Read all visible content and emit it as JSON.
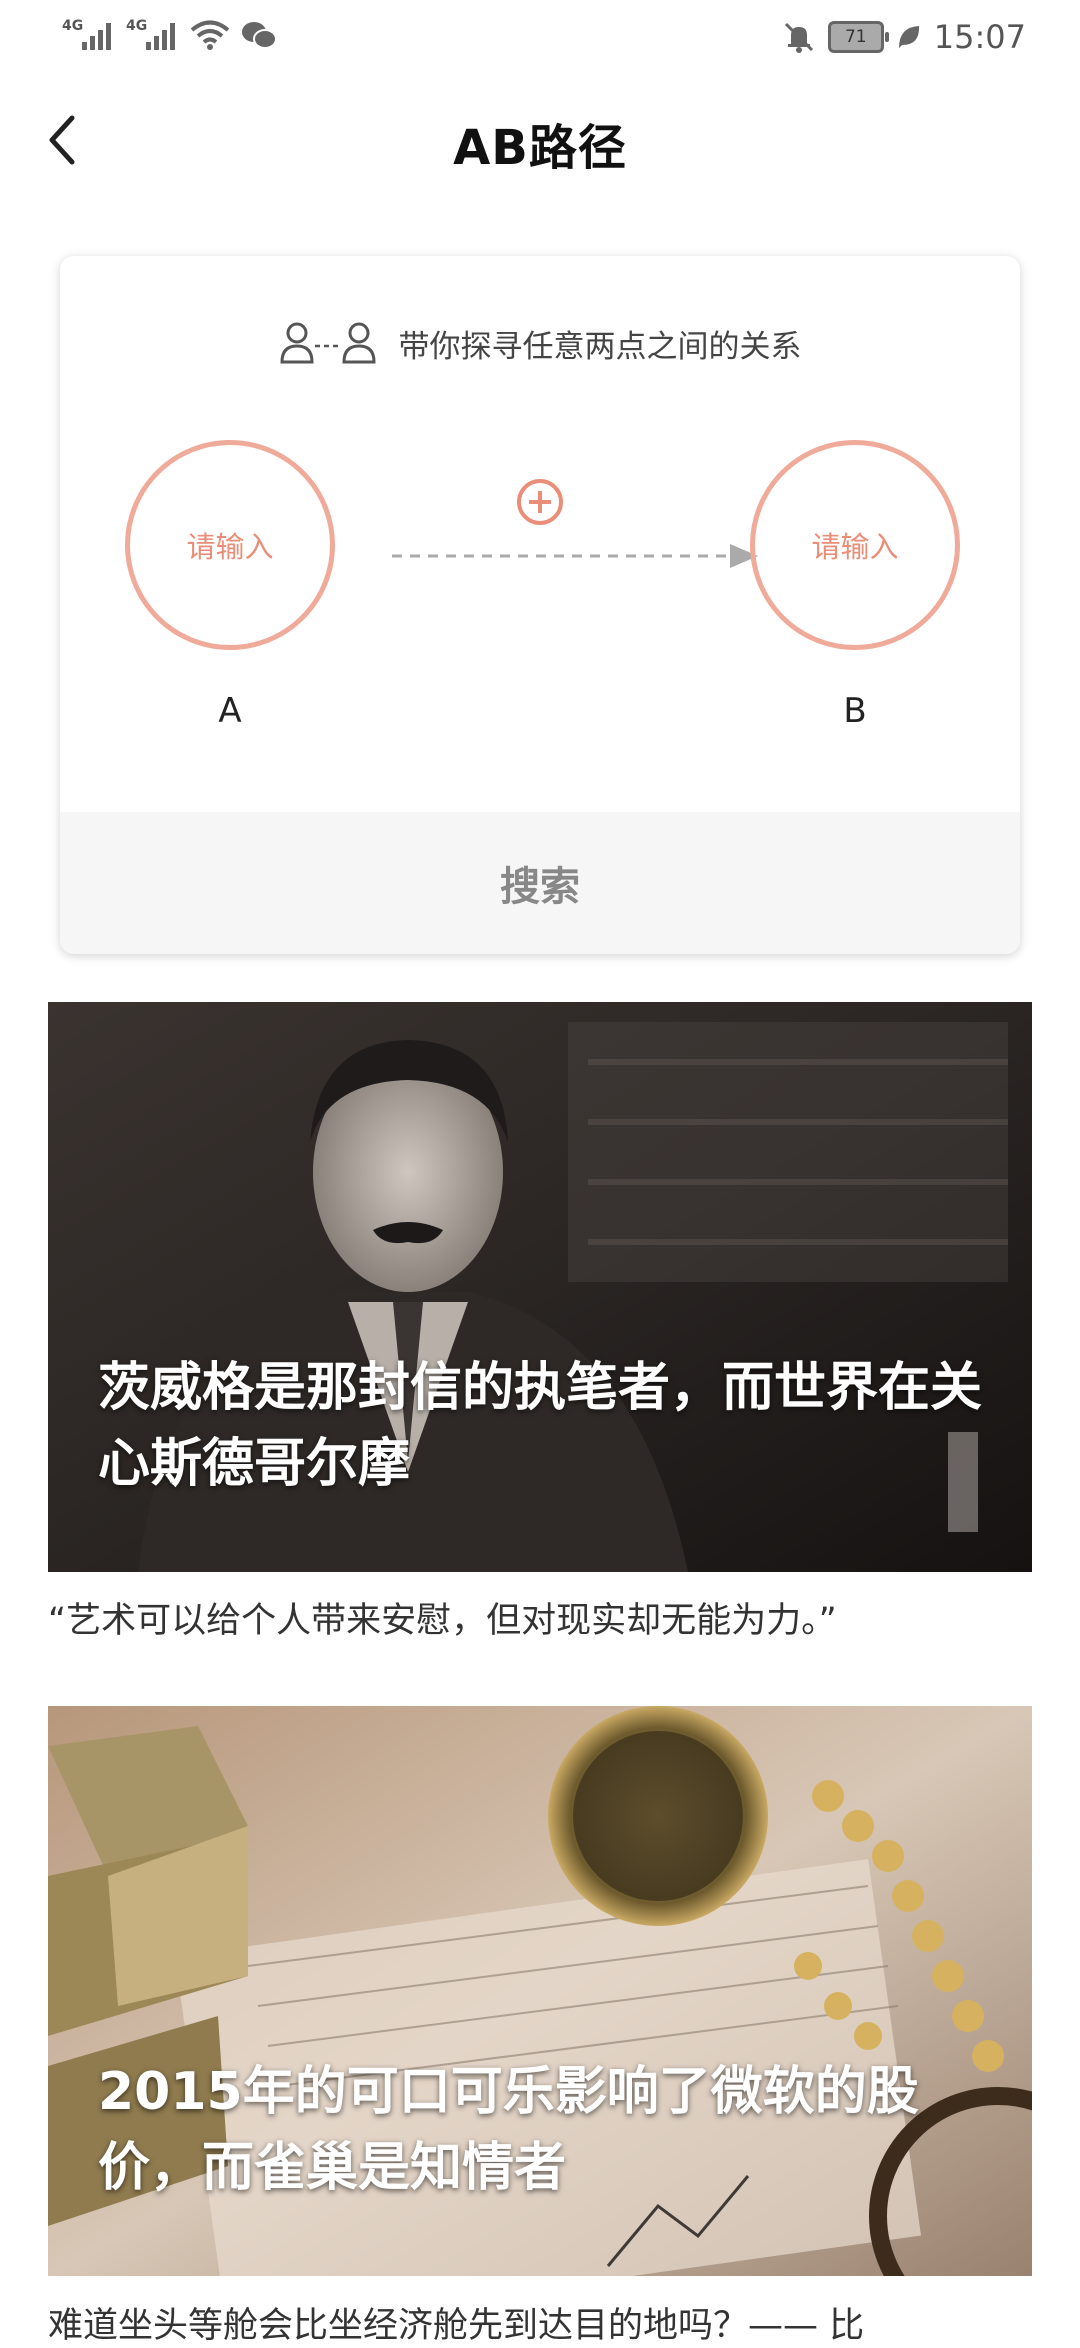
{
  "status_bar": {
    "signal1_label": "4G",
    "signal2_label": "4G",
    "battery": "71",
    "time": "15:07",
    "icons": [
      "signal-icon",
      "signal-icon",
      "wifi-icon",
      "wechat-icon",
      "mute-bell-icon",
      "battery-icon",
      "leaf-icon"
    ]
  },
  "header": {
    "title": "AB路径",
    "back_icon": "chevron-left-icon"
  },
  "card": {
    "subtitle": "带你探寻任意两点之间的关系",
    "node_a": {
      "placeholder": "请输入",
      "label": "A"
    },
    "node_b": {
      "placeholder": "请输入",
      "label": "B"
    },
    "add_icon": "plus-circle-icon",
    "search_label": "搜索",
    "accent_color": "#f0aa9a"
  },
  "articles": [
    {
      "title": "茨威格是那封信的执笔者，而世界在关心斯德哥尔摩",
      "description": "“艺术可以给个人带来安慰，但对现实却无能为力。”"
    },
    {
      "title": "2015年的可口可乐影响了微软的股价，而雀巢是知情者",
      "description": "难道坐头等舱会比坐经济舱先到达目的地吗？—— 比"
    }
  ]
}
